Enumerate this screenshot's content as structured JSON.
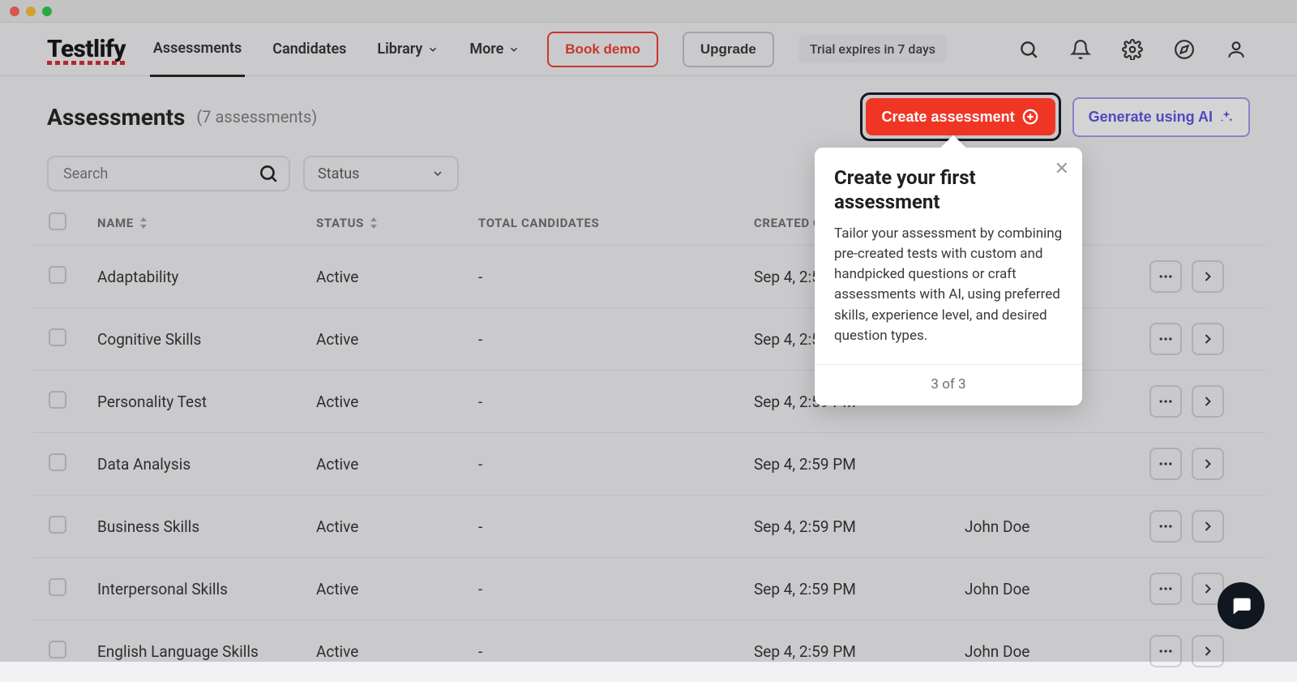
{
  "logo": "Testlify",
  "nav": {
    "assessments": "Assessments",
    "candidates": "Candidates",
    "library": "Library",
    "more": "More"
  },
  "topbuttons": {
    "book_demo": "Book demo",
    "upgrade": "Upgrade",
    "trial_chip": "Trial expires in 7 days"
  },
  "page": {
    "title": "Assessments",
    "count_label": "(7 assessments)",
    "create_btn": "Create assessment",
    "generate_ai_btn": "Generate using AI"
  },
  "filters": {
    "search_placeholder": "Search",
    "status_label": "Status"
  },
  "columns": {
    "name": "NAME",
    "status": "STATUS",
    "total": "TOTAL CANDIDATES",
    "created_on": "CREATED ON",
    "created_by_hidden": ""
  },
  "rows": [
    {
      "name": "Adaptability",
      "status": "Active",
      "total": "-",
      "created_on": "Sep 4, 2:59 PM",
      "created_by": ""
    },
    {
      "name": "Cognitive Skills",
      "status": "Active",
      "total": "-",
      "created_on": "Sep 4, 2:59 PM",
      "created_by": ""
    },
    {
      "name": "Personality Test",
      "status": "Active",
      "total": "-",
      "created_on": "Sep 4, 2:59 PM",
      "created_by": ""
    },
    {
      "name": "Data Analysis",
      "status": "Active",
      "total": "-",
      "created_on": "Sep 4, 2:59 PM",
      "created_by": ""
    },
    {
      "name": "Business Skills",
      "status": "Active",
      "total": "-",
      "created_on": "Sep 4, 2:59 PM",
      "created_by": "John Doe"
    },
    {
      "name": "Interpersonal Skills",
      "status": "Active",
      "total": "-",
      "created_on": "Sep 4, 2:59 PM",
      "created_by": "John Doe"
    },
    {
      "name": "English Language Skills",
      "status": "Active",
      "total": "-",
      "created_on": "Sep 4, 2:59 PM",
      "created_by": "John Doe"
    }
  ],
  "popover": {
    "title": "Create your first assessment",
    "body": "Tailor your assessment by combining pre-created tests with custom and handpicked questions or craft assessments with AI, using preferred skills, experience level, and desired question types.",
    "step": "3 of 3"
  }
}
